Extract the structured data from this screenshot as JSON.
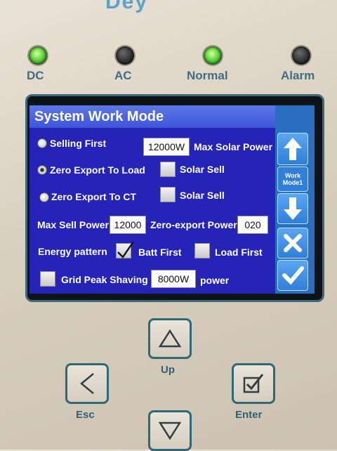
{
  "leds": [
    {
      "label": "DC",
      "on": true
    },
    {
      "label": "AC",
      "on": false
    },
    {
      "label": "Normal",
      "on": true
    },
    {
      "label": "Alarm",
      "on": false
    }
  ],
  "screen": {
    "title": "System Work Mode",
    "selling_first": "Selling First",
    "max_solar_value": "12000W",
    "max_solar_label": "Max Solar Power",
    "zero_export_load": "Zero Export To Load",
    "solar_sell_1": "Solar Sell",
    "zero_export_ct": "Zero Export To CT",
    "solar_sell_2": "Solar Sell",
    "max_sell_label": "Max Sell Power",
    "max_sell_value": "12000",
    "zero_export_power_label": "Zero-export Power",
    "zero_export_power_value": "020",
    "energy_pattern_label": "Energy pattern",
    "batt_first": "Batt First",
    "load_first": "Load First",
    "grid_peak_label": "Grid Peak Shaving",
    "grid_peak_value": "8000W",
    "power_label": "power",
    "selected_mode": "Zero Export To Load",
    "batt_first_checked": true
  },
  "sidebar": {
    "work_mode_line1": "Work",
    "work_mode_line2": "Mode1"
  },
  "keys": {
    "up": "Up",
    "esc": "Esc",
    "enter": "Enter"
  },
  "colors": {
    "screen_bg": "#2523b8",
    "title_bar": "#4a63e0",
    "led_green": "#5bd43a",
    "label_teal": "#3a6f86"
  }
}
